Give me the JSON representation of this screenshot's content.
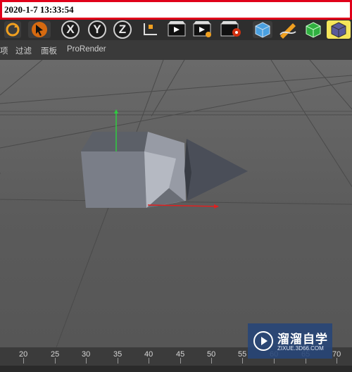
{
  "timestamp": "2020-1-7 13:33:54",
  "toolbar": {
    "axis_x": "X",
    "axis_y": "Y",
    "axis_z": "Z",
    "icons": [
      "redo-icon",
      "select-arrow-icon",
      "x-axis-lock",
      "y-axis-lock",
      "z-axis-lock",
      "coordinate-system-icon",
      "render-view-icon",
      "render-to-viewer-icon",
      "render-settings-icon",
      "cube-primitive-icon",
      "pen-spline-icon",
      "subdivision-icon",
      "deformer-icon"
    ]
  },
  "menu": {
    "items": [
      "项",
      "过滤",
      "面板",
      "ProRender"
    ]
  },
  "timeline": {
    "labels": [
      "20",
      "25",
      "30",
      "35",
      "40",
      "45",
      "50",
      "55",
      "60",
      "65",
      "70"
    ]
  },
  "watermark": {
    "title": "溜溜自学",
    "subtitle": "ZIXUE.3D66.COM"
  },
  "colors": {
    "stamp_border": "#e0001a",
    "viewport_bg": "#5f5f5f",
    "y_axis": "#2ecc40",
    "x_axis": "#e02020",
    "watermark_bg": "#284678"
  }
}
